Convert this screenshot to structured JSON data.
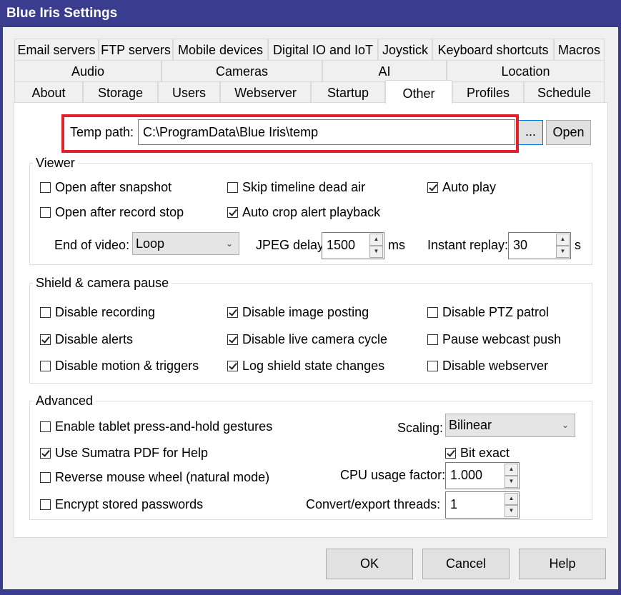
{
  "window": {
    "title": "Blue Iris Settings"
  },
  "tabs": {
    "row1": [
      "Email servers",
      "FTP servers",
      "Mobile devices",
      "Digital IO and IoT",
      "Joystick",
      "Keyboard shortcuts",
      "Macros"
    ],
    "row2": [
      "Audio",
      "Cameras",
      "AI",
      "Location"
    ],
    "row3": [
      "About",
      "Storage",
      "Users",
      "Webserver",
      "Startup",
      "Other",
      "Profiles",
      "Schedule"
    ],
    "active": "Other"
  },
  "temp_path": {
    "label": "Temp path:",
    "value": "C:\\ProgramData\\Blue Iris\\temp",
    "browse_label": "...",
    "open_label": "Open"
  },
  "viewer": {
    "title": "Viewer",
    "open_after_snapshot": {
      "label": "Open after snapshot",
      "checked": false
    },
    "skip_timeline_dead_air": {
      "label": "Skip timeline dead air",
      "checked": false
    },
    "auto_play": {
      "label": "Auto play",
      "checked": true
    },
    "open_after_record_stop": {
      "label": "Open after record stop",
      "checked": false
    },
    "auto_crop_alert_playback": {
      "label": "Auto crop alert playback",
      "checked": true
    },
    "end_of_video_label": "End of video:",
    "end_of_video_value": "Loop",
    "jpeg_delay_label": "JPEG delay:",
    "jpeg_delay_value": "1500",
    "jpeg_delay_unit": "ms",
    "instant_replay_label": "Instant replay:",
    "instant_replay_value": "30",
    "instant_replay_unit": "s"
  },
  "shield": {
    "title": "Shield & camera pause",
    "disable_recording": {
      "label": "Disable recording",
      "checked": false
    },
    "disable_image_posting": {
      "label": "Disable image posting",
      "checked": true
    },
    "disable_ptz_patrol": {
      "label": "Disable PTZ patrol",
      "checked": false
    },
    "disable_alerts": {
      "label": "Disable alerts",
      "checked": true
    },
    "disable_live_camera_cycle": {
      "label": "Disable live camera cycle",
      "checked": true
    },
    "pause_webcast_push": {
      "label": "Pause webcast push",
      "checked": false
    },
    "disable_motion_triggers": {
      "label": "Disable motion & triggers",
      "checked": false
    },
    "log_shield_state_changes": {
      "label": "Log shield state changes",
      "checked": true
    },
    "disable_webserver": {
      "label": "Disable webserver",
      "checked": false
    }
  },
  "advanced": {
    "title": "Advanced",
    "tablet_gestures": {
      "label": "Enable tablet press-and-hold gestures",
      "checked": false
    },
    "sumatra_pdf": {
      "label": "Use Sumatra PDF for Help",
      "checked": true
    },
    "reverse_wheel": {
      "label": "Reverse mouse wheel (natural mode)",
      "checked": false
    },
    "encrypt_passwords": {
      "label": "Encrypt stored passwords",
      "checked": false
    },
    "scaling_label": "Scaling:",
    "scaling_value": "Bilinear",
    "bit_exact": {
      "label": "Bit exact",
      "checked": true
    },
    "cpu_usage_label": "CPU usage factor:",
    "cpu_usage_value": "1.000",
    "threads_label": "Convert/export threads:",
    "threads_value": "1"
  },
  "footer": {
    "ok": "OK",
    "cancel": "Cancel",
    "help": "Help"
  }
}
